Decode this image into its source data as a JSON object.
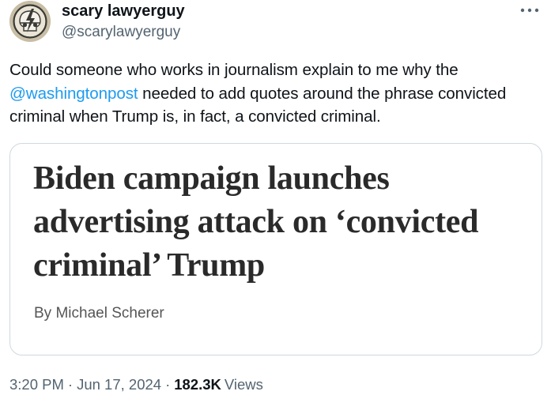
{
  "author": {
    "display_name": "scary lawyerguy",
    "handle": "@scarylawyerguy",
    "avatar_icon": "steal-your-face-skull-icon"
  },
  "more_icon": "ellipsis-icon",
  "tweet": {
    "text_before": "Could someone who works in journalism explain to me why the ",
    "mention": "@washingtonpost",
    "text_after": " needed to add quotes around the phrase convicted criminal when Trump is, in fact, a convicted criminal."
  },
  "media": {
    "headline": "Biden campaign launches advertising attack on ‘convicted criminal’ Trump",
    "byline": "By Michael Scherer"
  },
  "meta": {
    "time": "3:20 PM",
    "separator": "·",
    "date": "Jun 17, 2024",
    "views_count": "182.3K",
    "views_label": "Views"
  },
  "colors": {
    "text_primary": "#0f1419",
    "text_secondary": "#536471",
    "link": "#1d9bf0",
    "border": "#cfd9de",
    "headline": "#2a2a2a"
  }
}
